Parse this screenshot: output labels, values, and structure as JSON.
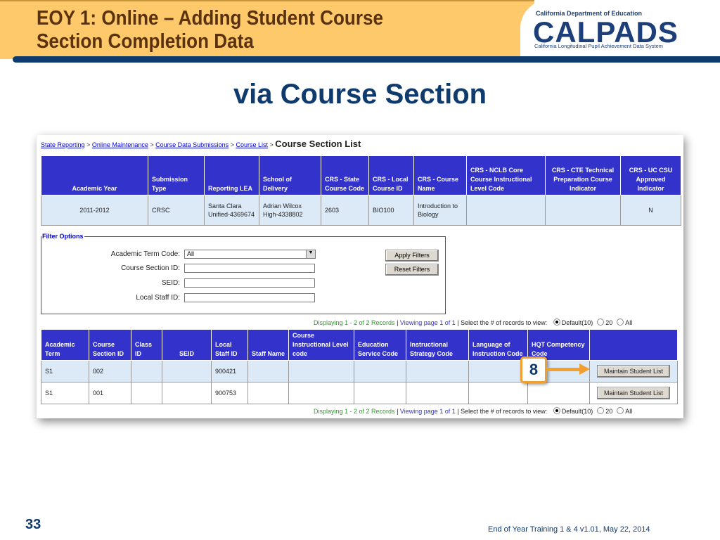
{
  "header": {
    "title_line1": "EOY 1: Online – Adding Student Course",
    "title_line2": "Section Completion Data"
  },
  "logo": {
    "dept": "California Department of Education",
    "name": "CALPADS",
    "subtitle": "California Longitudinal Pupil Achievement Data System"
  },
  "subtitle": "via Course Section",
  "breadcrumb": {
    "items": [
      "State Reporting",
      "Online Maintenance",
      "Course Data Submissions",
      "Course List"
    ],
    "current": "Course Section List",
    "sep": ">"
  },
  "course_table": {
    "headers": [
      "Academic Year",
      "Submission Type",
      "Reporting LEA",
      "School of Delivery",
      "CRS - State Course Code",
      "CRS - Local Course ID",
      "CRS - Course Name",
      "CRS - NCLB Core Course Instructional Level Code",
      "CRS - CTE Technical Preparation Course Indicator",
      "CRS - UC CSU Approved Indicator"
    ],
    "row": [
      "2011-2012",
      "CRSC",
      "Santa Clara Unified-4369674",
      "Adrian Wilcox High-4338802",
      "2603",
      "BIO100",
      "Introduction to Biology",
      "",
      "",
      "N"
    ]
  },
  "filter": {
    "legend": "Filter Options",
    "fields": [
      {
        "label": "Academic Term Code:",
        "value": "All"
      },
      {
        "label": "Course Section ID:",
        "value": ""
      },
      {
        "label": "SEID:",
        "value": ""
      },
      {
        "label": "Local Staff ID:",
        "value": ""
      }
    ],
    "apply": "Apply Filters",
    "reset": "Reset Filters"
  },
  "paging": {
    "displaying": "Displaying 1 - 2 of 2 Records",
    "sep": " | ",
    "viewing": "Viewing page 1 of 1",
    "select": "| Select the # of records to view:",
    "options": [
      "Default(10)",
      "20",
      "All"
    ]
  },
  "section_table": {
    "headers": [
      "Academic Term",
      "Course Section ID",
      "Class ID",
      "SEID",
      "Local Staff ID",
      "Staff Name",
      "Course Instructional Level code",
      "Education Service Code",
      "Instructional Strategy Code",
      "Language of Instruction Code",
      "HQT Competency Code",
      ""
    ],
    "rows": [
      [
        "S1",
        "002",
        "",
        "",
        "900421",
        "",
        "",
        "",
        "",
        "",
        "",
        "Maintain Student List"
      ],
      [
        "S1",
        "001",
        "",
        "",
        "900753",
        "",
        "",
        "",
        "",
        "",
        "",
        "Maintain Student List"
      ]
    ]
  },
  "callout": "8",
  "page_number": "33",
  "footer": "End of Year Training 1 & 4 v1.01, May 22, 2014",
  "colors": {
    "header_bg": "#fdc96a",
    "title": "#5a3210",
    "navy": "#0e3a6e",
    "table_header": "#3333cc",
    "callout": "#f0a030"
  }
}
